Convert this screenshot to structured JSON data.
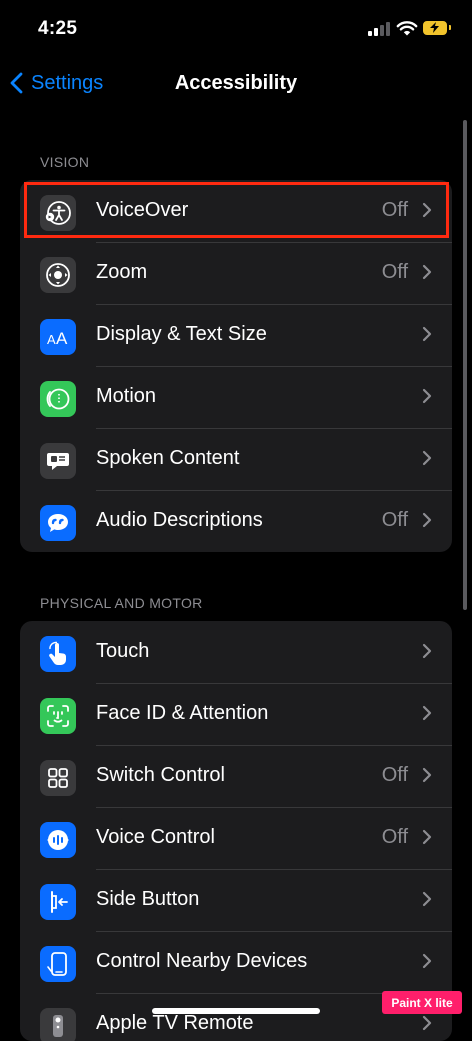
{
  "status_bar": {
    "time": "4:25"
  },
  "nav": {
    "back_label": "Settings",
    "title": "Accessibility"
  },
  "sections": [
    {
      "header": "VISION",
      "rows": [
        {
          "label": "VoiceOver",
          "value": "Off",
          "icon": "voiceover-icon",
          "icon_color": "#3a3a3c"
        },
        {
          "label": "Zoom",
          "value": "Off",
          "icon": "zoom-icon",
          "icon_color": "#3a3a3c"
        },
        {
          "label": "Display & Text Size",
          "value": "",
          "icon": "text-size-icon",
          "icon_color": "#0a6cff"
        },
        {
          "label": "Motion",
          "value": "",
          "icon": "motion-icon",
          "icon_color": "#34c759"
        },
        {
          "label": "Spoken Content",
          "value": "",
          "icon": "spoken-content-icon",
          "icon_color": "#3a3a3c"
        },
        {
          "label": "Audio Descriptions",
          "value": "Off",
          "icon": "audio-descriptions-icon",
          "icon_color": "#0a6cff"
        }
      ]
    },
    {
      "header": "PHYSICAL AND MOTOR",
      "rows": [
        {
          "label": "Touch",
          "value": "",
          "icon": "touch-icon",
          "icon_color": "#0a6cff"
        },
        {
          "label": "Face ID & Attention",
          "value": "",
          "icon": "face-id-icon",
          "icon_color": "#34c759"
        },
        {
          "label": "Switch Control",
          "value": "Off",
          "icon": "switch-control-icon",
          "icon_color": "#3a3a3c"
        },
        {
          "label": "Voice Control",
          "value": "Off",
          "icon": "voice-control-icon",
          "icon_color": "#0a6cff"
        },
        {
          "label": "Side Button",
          "value": "",
          "icon": "side-button-icon",
          "icon_color": "#0a6cff"
        },
        {
          "label": "Control Nearby Devices",
          "value": "",
          "icon": "nearby-devices-icon",
          "icon_color": "#0a6cff"
        },
        {
          "label": "Apple TV Remote",
          "value": "",
          "icon": "apple-tv-remote-icon",
          "icon_color": "#3a3a3c"
        }
      ]
    }
  ],
  "watermark": "Paint X lite",
  "colors": {
    "accent": "#0a84ff",
    "highlight_border": "#ff2a10",
    "battery": "#f2c42c"
  }
}
